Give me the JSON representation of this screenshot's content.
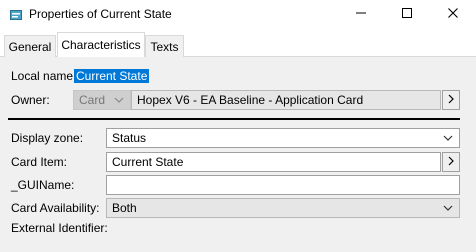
{
  "window": {
    "title": "Properties of Current State",
    "minimize_icon": "minimize-icon",
    "maximize_icon": "maximize-icon",
    "close_icon": "close-icon"
  },
  "tabs": [
    {
      "label": "General",
      "active": false
    },
    {
      "label": "Characteristics",
      "active": true
    },
    {
      "label": "Texts",
      "active": false
    }
  ],
  "form": {
    "local_name_label": "Local name:",
    "local_name_value": "Current State",
    "owner_label": "Owner:",
    "owner_type": "Card",
    "owner_value": "Hopex V6 - EA Baseline - Application Card",
    "display_zone_label": "Display zone:",
    "display_zone_value": "Status",
    "card_item_label": "Card Item:",
    "card_item_value": "Current State",
    "gui_name_label": "_GUIName:",
    "gui_name_value": "",
    "card_availability_label": "Card Availability:",
    "card_availability_value": "Both",
    "external_identifier_label": "External Identifier:"
  },
  "colors": {
    "selection": "#0078d7",
    "panel": "#f0f0f0",
    "disabled_field": "#cfcfcf"
  }
}
